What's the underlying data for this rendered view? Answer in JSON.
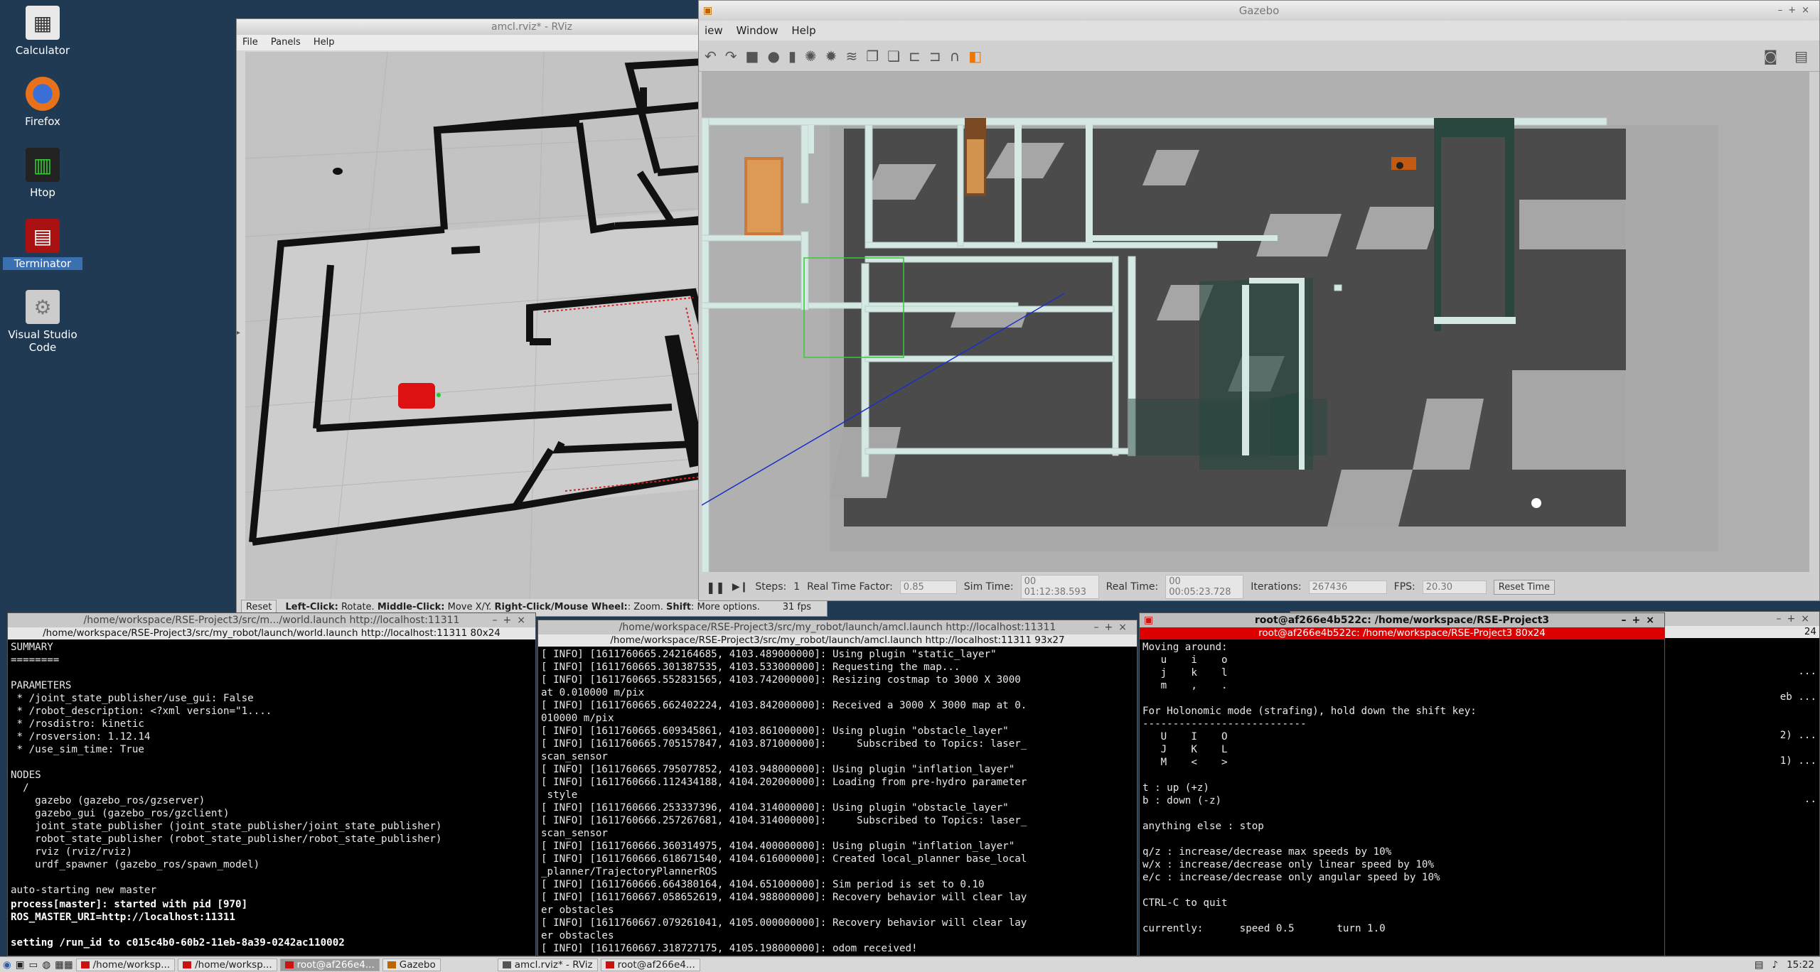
{
  "desktop": {
    "icons": [
      {
        "label": "Calculator"
      },
      {
        "label": "Firefox"
      },
      {
        "label": "Htop"
      },
      {
        "label": "Terminator"
      },
      {
        "label": "Visual Studio\nCode"
      }
    ]
  },
  "rviz": {
    "title": "amcl.rviz* - RViz",
    "menu": [
      "File",
      "Panels",
      "Help"
    ],
    "status": {
      "reset": "Reset",
      "hint_l": "Left-Click:",
      "hint_l_v": " Rotate. ",
      "hint_m": "Middle-Click:",
      "hint_m_v": " Move X/Y. ",
      "hint_r": "Right-Click/Mouse Wheel:",
      "hint_r_v": ": Zoom. ",
      "hint_s": "Shift",
      "hint_s_v": ": More options.",
      "fps": "31 fps"
    }
  },
  "gazebo": {
    "title": "Gazebo",
    "menu": [
      "iew",
      "Window",
      "Help"
    ],
    "bottom": {
      "steps_label": "Steps:",
      "steps_value": "1",
      "rtf_label": "Real Time Factor:",
      "rtf_value": "0.85",
      "sim_label": "Sim Time:",
      "sim_value": "00 01:12:38.593",
      "real_label": "Real Time:",
      "real_value": "00 00:05:23.728",
      "iter_label": "Iterations:",
      "iter_value": "267436",
      "fps_label": "FPS:",
      "fps_value": "20.30",
      "reset": "Reset Time"
    }
  },
  "term1": {
    "title": "/home/workspace/RSE-Project3/src/m.../world.launch http://localhost:11311",
    "subtitle": "/home/workspace/RSE-Project3/src/my_robot/launch/world.launch http://localhost:11311 80x24",
    "lines": [
      "SUMMARY",
      "========",
      "",
      "PARAMETERS",
      " * /joint_state_publisher/use_gui: False",
      " * /robot_description: <?xml version=\"1....",
      " * /rosdistro: kinetic",
      " * /rosversion: 1.12.14",
      " * /use_sim_time: True",
      "",
      "NODES",
      "  /",
      "    gazebo (gazebo_ros/gzserver)",
      "    gazebo_gui (gazebo_ros/gzclient)",
      "    joint_state_publisher (joint_state_publisher/joint_state_publisher)",
      "    robot_state_publisher (robot_state_publisher/robot_state_publisher)",
      "    rviz (rviz/rviz)",
      "    urdf_spawner (gazebo_ros/spawn_model)",
      "",
      "auto-starting new master"
    ],
    "bold_lines": [
      "process[master]: started with pid [970]",
      "ROS_MASTER_URI=http://localhost:11311",
      "",
      "setting /run_id to c015c4b0-60b2-11eb-8a39-0242ac110002"
    ]
  },
  "term2": {
    "title": "/home/workspace/RSE-Project3/src/my_robot/launch/amcl.launch http://localhost:11311",
    "subtitle": "/home/workspace/RSE-Project3/src/my_robot/launch/amcl.launch http://localhost:11311 93x27",
    "lines": [
      "[ INFO] [1611760665.242164685, 4103.489000000]: Using plugin \"static_layer\"",
      "[ INFO] [1611760665.301387535, 4103.533000000]: Requesting the map...",
      "[ INFO] [1611760665.552831565, 4103.742000000]: Resizing costmap to 3000 X 3000",
      "at 0.010000 m/pix",
      "[ INFO] [1611760665.662402224, 4103.842000000]: Received a 3000 X 3000 map at 0.",
      "010000 m/pix",
      "[ INFO] [1611760665.609345861, 4103.861000000]: Using plugin \"obstacle_layer\"",
      "[ INFO] [1611760665.705157847, 4103.871000000]:     Subscribed to Topics: laser_",
      "scan_sensor",
      "[ INFO] [1611760665.795077852, 4103.948000000]: Using plugin \"inflation_layer\"",
      "[ INFO] [1611760666.112434188, 4104.202000000]: Loading from pre-hydro parameter",
      " style",
      "[ INFO] [1611760666.253337396, 4104.314000000]: Using plugin \"obstacle_layer\"",
      "[ INFO] [1611760666.257267681, 4104.314000000]:     Subscribed to Topics: laser_",
      "scan_sensor",
      "[ INFO] [1611760666.360314975, 4104.400000000]: Using plugin \"inflation_layer\"",
      "[ INFO] [1611760666.618671540, 4104.616000000]: Created local_planner base_local",
      "_planner/TrajectoryPlannerROS",
      "[ INFO] [1611760666.664380164, 4104.651000000]: Sim period is set to 0.10",
      "[ INFO] [1611760667.058652619, 4104.988000000]: Recovery behavior will clear lay",
      "er obstacles",
      "[ INFO] [1611760667.079261041, 4105.000000000]: Recovery behavior will clear lay",
      "er obstacles",
      "[ INFO] [1611760667.318727175, 4105.198000000]: odom received!"
    ]
  },
  "term3": {
    "title": "root@af266e4b522c: /home/workspace/RSE-Project3",
    "subtitle": "root@af266e4b522c: /home/workspace/RSE-Project3 80x24",
    "lines": [
      "Moving around:",
      "   u    i    o",
      "   j    k    l",
      "   m    ,    .",
      "",
      "For Holonomic mode (strafing), hold down the shift key:",
      "---------------------------",
      "   U    I    O",
      "   J    K    L",
      "   M    <    >",
      "",
      "t : up (+z)",
      "b : down (-z)",
      "",
      "anything else : stop",
      "",
      "q/z : increase/decrease max speeds by 10%",
      "w/x : increase/decrease only linear speed by 10%",
      "e/c : increase/decrease only angular speed by 10%",
      "",
      "CTRL-C to quit",
      "",
      "currently:      speed 0.5       turn 1.0"
    ]
  },
  "term4": {
    "sub": "24",
    "lines": [
      "",
      "",
      " ...",
      "",
      "eb ...",
      "",
      "",
      "2) ...",
      "",
      "1) ...",
      "",
      "",
      "..",
      "",
      "",
      ""
    ]
  },
  "taskbar": {
    "items": [
      "/home/worksp...",
      "/home/worksp...",
      "root@af266e4...",
      "Gazebo",
      "amcl.rviz* - RViz",
      "root@af266e4..."
    ],
    "clock": "15:22"
  }
}
